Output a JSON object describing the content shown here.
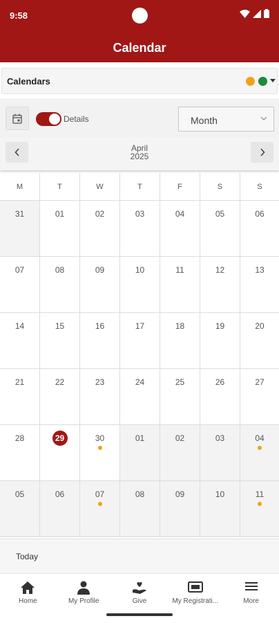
{
  "status_bar": {
    "time": "9:58",
    "icons": [
      "wifi-icon",
      "signal-icon",
      "battery-icon"
    ]
  },
  "header": {
    "title": "Calendar"
  },
  "calendars_selector": {
    "label": "Calendars",
    "dots": [
      {
        "color": "#f0a21a"
      },
      {
        "color": "#1e8a3c"
      }
    ]
  },
  "toolbar": {
    "details_label": "Details",
    "details_enabled": true,
    "view_value": "Month"
  },
  "month_nav": {
    "month": "April",
    "year": "2025"
  },
  "weekdays": [
    "M",
    "T",
    "W",
    "T",
    "F",
    "S",
    "S"
  ],
  "weeks": [
    [
      {
        "day": "31",
        "outside": true
      },
      {
        "day": "01"
      },
      {
        "day": "02"
      },
      {
        "day": "03"
      },
      {
        "day": "04"
      },
      {
        "day": "05"
      },
      {
        "day": "06"
      }
    ],
    [
      {
        "day": "07"
      },
      {
        "day": "08"
      },
      {
        "day": "09"
      },
      {
        "day": "10"
      },
      {
        "day": "11"
      },
      {
        "day": "12"
      },
      {
        "day": "13"
      }
    ],
    [
      {
        "day": "14"
      },
      {
        "day": "15"
      },
      {
        "day": "16"
      },
      {
        "day": "17"
      },
      {
        "day": "18"
      },
      {
        "day": "19"
      },
      {
        "day": "20"
      }
    ],
    [
      {
        "day": "21"
      },
      {
        "day": "22"
      },
      {
        "day": "23"
      },
      {
        "day": "24"
      },
      {
        "day": "25"
      },
      {
        "day": "26"
      },
      {
        "day": "27"
      }
    ],
    [
      {
        "day": "28"
      },
      {
        "day": "29",
        "today": true
      },
      {
        "day": "30",
        "event": true
      },
      {
        "day": "01",
        "outside": true
      },
      {
        "day": "02",
        "outside": true
      },
      {
        "day": "03",
        "outside": true
      },
      {
        "day": "04",
        "outside": true,
        "event": true
      }
    ],
    [
      {
        "day": "05",
        "outside": true
      },
      {
        "day": "06",
        "outside": true
      },
      {
        "day": "07",
        "outside": true,
        "event": true
      },
      {
        "day": "08",
        "outside": true
      },
      {
        "day": "09",
        "outside": true
      },
      {
        "day": "10",
        "outside": true
      },
      {
        "day": "11",
        "outside": true,
        "event": true
      }
    ]
  ],
  "today_bar": {
    "label": "Today"
  },
  "bottom_nav": [
    {
      "label": "Home",
      "icon": "home-icon"
    },
    {
      "label": "My Profile",
      "icon": "person-icon"
    },
    {
      "label": "Give",
      "icon": "give-hand-heart-icon"
    },
    {
      "label": "My Registrati...",
      "icon": "ticket-icon"
    },
    {
      "label": "More",
      "icon": "menu-icon"
    }
  ],
  "colors": {
    "brand": "#a01716",
    "event_dot": "#f0a21a"
  }
}
